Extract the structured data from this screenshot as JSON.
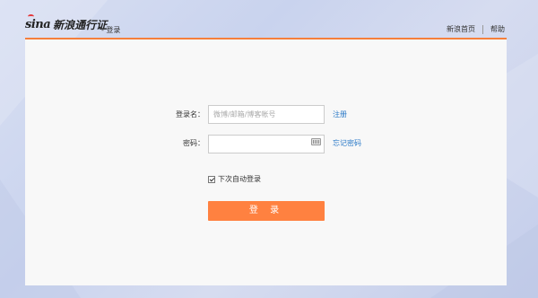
{
  "header": {
    "logo_mark": "sina",
    "logo_text": "新浪通行证",
    "sub_title": "- 登录",
    "links": [
      "新浪首页",
      "帮助"
    ]
  },
  "form": {
    "username_label": "登录名：",
    "username_placeholder": "微博/邮箱/博客帐号",
    "register_link": "注册",
    "password_label": "密码：",
    "password_value": "",
    "forgot_link": "忘记密码",
    "remember_label": "下次自动登录",
    "remember_checked": true,
    "submit_label": "登 录"
  },
  "colors": {
    "accent": "#ff8140",
    "link": "#2a79c7",
    "brand_red": "#e4393c"
  },
  "icons": {
    "keyboard": "keyboard-icon",
    "checkbox": "checkbox-checked-icon"
  }
}
